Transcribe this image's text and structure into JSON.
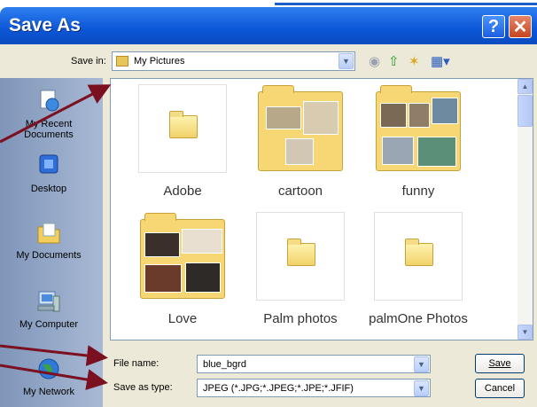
{
  "window": {
    "title": "Save As",
    "help_label": "?",
    "close_label": "✕"
  },
  "toolbar": {
    "save_in_label": "Save in:",
    "save_in_value": "My Pictures"
  },
  "places": [
    {
      "label": "My Recent Documents",
      "icon": "recent-documents-icon"
    },
    {
      "label": "Desktop",
      "icon": "desktop-icon"
    },
    {
      "label": "My Documents",
      "icon": "my-documents-icon"
    },
    {
      "label": "My Computer",
      "icon": "my-computer-icon"
    },
    {
      "label": "My Network",
      "icon": "my-network-icon"
    }
  ],
  "folders": [
    {
      "name": "Adobe"
    },
    {
      "name": "cartoon"
    },
    {
      "name": "funny"
    },
    {
      "name": "Love"
    },
    {
      "name": "Palm photos"
    },
    {
      "name": "palmOne Photos"
    }
  ],
  "form": {
    "file_name_label": "File name:",
    "file_name_value": "blue_bgrd",
    "save_as_type_label": "Save as type:",
    "save_as_type_value": "JPEG (*.JPG;*.JPEG;*.JPE;*.JFIF)",
    "save_button": "Save",
    "cancel_button": "Cancel"
  },
  "colors": {
    "title_bar": "#0b56d6",
    "annotation_arrow": "#7a1020"
  }
}
